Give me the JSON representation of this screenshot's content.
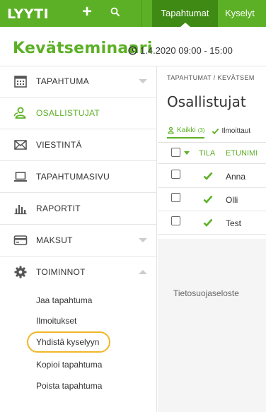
{
  "topbar": {
    "logo": "LYYTI",
    "add_label": "+",
    "search_icon": "search-icon",
    "tabs": [
      {
        "label": "Tapahtumat",
        "active": true
      },
      {
        "label": "Kyselyt",
        "active": false
      }
    ],
    "bg_color": "#5cb025"
  },
  "event": {
    "title": "Kevätseminaari",
    "date": "1.4.2020 09:00 - 15:00"
  },
  "sidebar": {
    "items": [
      {
        "label": "TAPAHTUMA",
        "icon": "calendar-icon"
      },
      {
        "label": "OSALLISTUJAT",
        "icon": "users-icon",
        "active": true
      },
      {
        "label": "VIESTINTÄ",
        "icon": "envelope-icon"
      },
      {
        "label": "TAPAHTUMASIVU",
        "icon": "laptop-icon"
      },
      {
        "label": "RAPORTIT",
        "icon": "bar-chart-icon"
      },
      {
        "label": "MAKSUT",
        "icon": "credit-card-icon"
      },
      {
        "label": "TOIMINNOT",
        "icon": "gear-icon",
        "expanded": true
      }
    ],
    "subitems": [
      "Jaa tapahtuma",
      "Ilmoitukset",
      "Yhdistä kyselyyn",
      "Kopioi tapahtuma",
      "Poista tapahtuma"
    ]
  },
  "main": {
    "breadcrumb": "TAPAHTUMAT   /   KEVÄTSEM",
    "heading": "Osallistujat",
    "filters": [
      {
        "label": "Kaikki",
        "count": "(3)",
        "active": true
      },
      {
        "label": "Ilmoittaut",
        "active": false
      }
    ],
    "columns": [
      "TILA",
      "ETUNIMI"
    ],
    "rows": [
      {
        "first_name": "Anna"
      },
      {
        "first_name": "Olli"
      },
      {
        "first_name": "Test"
      }
    ],
    "footer_text": "Tietosuojaseloste"
  }
}
